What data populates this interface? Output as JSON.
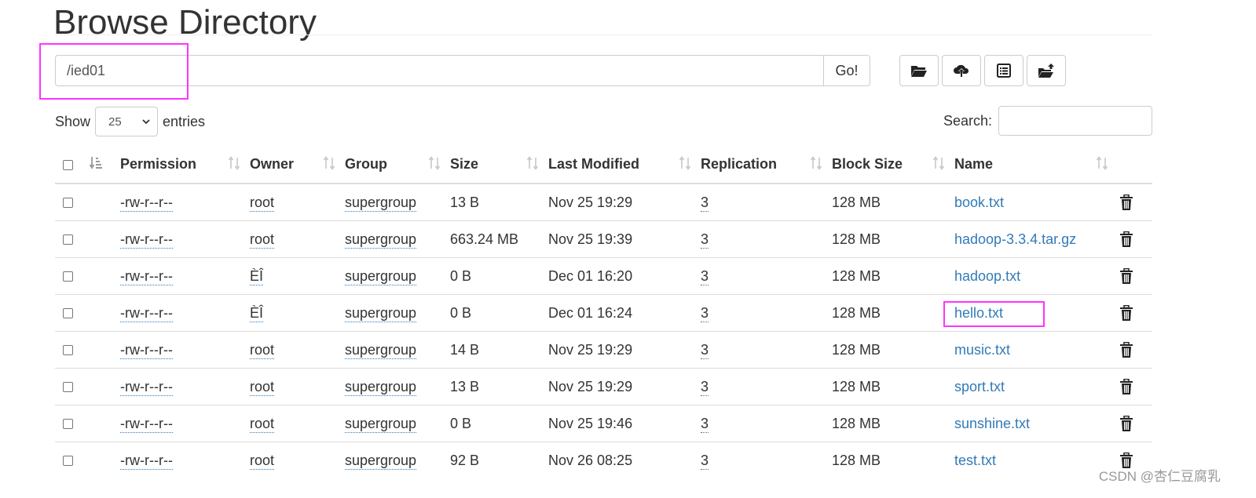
{
  "page_title": "Browse Directory",
  "path": {
    "value": "/ied01",
    "go_label": "Go!"
  },
  "toolbar": {
    "icons": [
      "folder-open-icon",
      "cloud-upload-icon",
      "list-alt-icon",
      "folder-upload-icon"
    ]
  },
  "show": {
    "prefix": "Show",
    "selected": "25",
    "suffix": "entries"
  },
  "search": {
    "label": "Search:",
    "value": ""
  },
  "table": {
    "headers": {
      "permission": "Permission",
      "owner": "Owner",
      "group": "Group",
      "size": "Size",
      "last_modified": "Last Modified",
      "replication": "Replication",
      "block_size": "Block Size",
      "name": "Name"
    },
    "rows": [
      {
        "permission": "-rw-r--r--",
        "owner": "root",
        "group": "supergroup",
        "size": "13 B",
        "modified": "Nov 25 19:29",
        "replication": "3",
        "block_size": "128 MB",
        "name": "book.txt"
      },
      {
        "permission": "-rw-r--r--",
        "owner": "root",
        "group": "supergroup",
        "size": "663.24 MB",
        "modified": "Nov 25 19:39",
        "replication": "3",
        "block_size": "128 MB",
        "name": "hadoop-3.3.4.tar.gz"
      },
      {
        "permission": "-rw-r--r--",
        "owner": "ÈÎ",
        "group": "supergroup",
        "size": "0 B",
        "modified": "Dec 01 16:20",
        "replication": "3",
        "block_size": "128 MB",
        "name": "hadoop.txt"
      },
      {
        "permission": "-rw-r--r--",
        "owner": "ÈÎ",
        "group": "supergroup",
        "size": "0 B",
        "modified": "Dec 01 16:24",
        "replication": "3",
        "block_size": "128 MB",
        "name": "hello.txt"
      },
      {
        "permission": "-rw-r--r--",
        "owner": "root",
        "group": "supergroup",
        "size": "14 B",
        "modified": "Nov 25 19:29",
        "replication": "3",
        "block_size": "128 MB",
        "name": "music.txt"
      },
      {
        "permission": "-rw-r--r--",
        "owner": "root",
        "group": "supergroup",
        "size": "13 B",
        "modified": "Nov 25 19:29",
        "replication": "3",
        "block_size": "128 MB",
        "name": "sport.txt"
      },
      {
        "permission": "-rw-r--r--",
        "owner": "root",
        "group": "supergroup",
        "size": "0 B",
        "modified": "Nov 25 19:46",
        "replication": "3",
        "block_size": "128 MB",
        "name": "sunshine.txt"
      },
      {
        "permission": "-rw-r--r--",
        "owner": "root",
        "group": "supergroup",
        "size": "92 B",
        "modified": "Nov 26 08:25",
        "replication": "3",
        "block_size": "128 MB",
        "name": "test.txt"
      }
    ]
  },
  "watermark": "CSDN @杏仁豆腐乳",
  "colors": {
    "link": "#337ab7",
    "highlight": "#ff33ff",
    "border": "#dddddd"
  }
}
